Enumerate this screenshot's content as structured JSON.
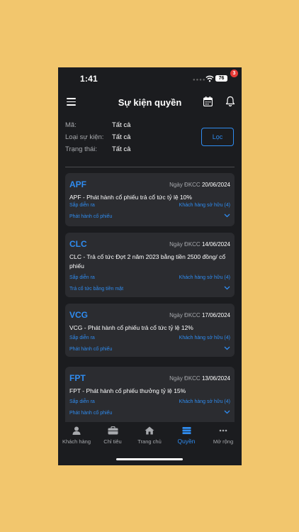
{
  "status_bar": {
    "time": "1:41",
    "battery": "76"
  },
  "header": {
    "title": "Sự kiện quyền",
    "notification_count": "3"
  },
  "filters": {
    "rows": [
      {
        "label": "Mã:",
        "value": "Tất cả"
      },
      {
        "label": "Loại sự kiện:",
        "value": "Tất cả"
      },
      {
        "label": "Trạng thái:",
        "value": "Tất cả"
      }
    ],
    "button_label": "Lọc"
  },
  "events": [
    {
      "ticker": "APF",
      "date_label": "Ngày ĐKCC",
      "date": "20/06/2024",
      "description": "APF - Phát hành cổ phiếu trả cổ tức tỷ lệ 10%",
      "status": "Sắp diễn ra",
      "owner": "Khách hàng sở hữu (4)",
      "type": "Phát hành cổ phiếu"
    },
    {
      "ticker": "CLC",
      "date_label": "Ngày ĐKCC",
      "date": "14/06/2024",
      "description": "CLC - Trả cổ tức Đợt 2 năm 2023 bằng tiền 2500 đồng/ cổ phiếu",
      "status": "Sắp diễn ra",
      "owner": "Khách hàng sở hữu (4)",
      "type": "Trả cổ tức bằng tiền mặt"
    },
    {
      "ticker": "VCG",
      "date_label": "Ngày ĐKCC",
      "date": "17/06/2024",
      "description": "VCG - Phát hành cổ phiếu trả cổ tức tỷ lệ 12%",
      "status": "Sắp diễn ra",
      "owner": "Khách hàng sở hữu (4)",
      "type": "Phát hành cổ phiếu"
    },
    {
      "ticker": "FPT",
      "date_label": "Ngày ĐKCC",
      "date": "13/06/2024",
      "description": "FPT - Phát hành cổ phiếu thưởng tỷ lệ 15%",
      "status": "Sắp diễn ra",
      "owner": "Khách hàng sở hữu (4)",
      "type": "Phát hành cổ phiếu"
    }
  ],
  "tabs": [
    {
      "label": "Khách hàng",
      "icon": "person-icon"
    },
    {
      "label": "Chỉ tiêu",
      "icon": "briefcase-icon"
    },
    {
      "label": "Trang chủ",
      "icon": "home-icon"
    },
    {
      "label": "Quyền",
      "icon": "rights-icon",
      "active": true
    },
    {
      "label": "Mở rộng",
      "icon": "more-icon"
    }
  ],
  "colors": {
    "accent": "#2f8cf0",
    "background": "#1b1c1f",
    "card": "#2b2c30",
    "badge": "#e53935"
  }
}
